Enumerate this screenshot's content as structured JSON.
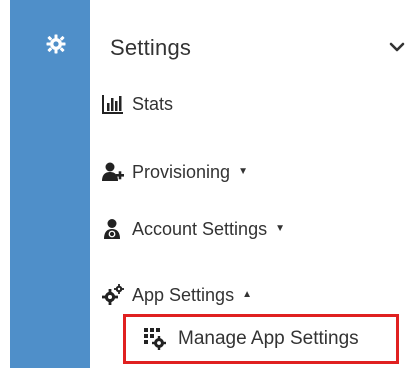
{
  "sidebar": {
    "rail_icon": "gear-icon",
    "accent_color": "#4f8fc9"
  },
  "menu": {
    "header": {
      "title": "Settings",
      "chevron": "chevron-down-icon"
    },
    "items": [
      {
        "label": "Stats",
        "icon": "bar-chart-icon",
        "caret": ""
      },
      {
        "label": "Provisioning",
        "icon": "user-plus-icon",
        "caret": "▼"
      },
      {
        "label": "Account Settings",
        "icon": "user-cog-icon",
        "caret": "▼"
      },
      {
        "label": "App Settings",
        "icon": "gears-icon",
        "caret": "▲"
      }
    ],
    "subitem": {
      "label": "Manage App Settings",
      "icon": "grid-cog-icon",
      "highlight_color": "#e02020"
    }
  }
}
